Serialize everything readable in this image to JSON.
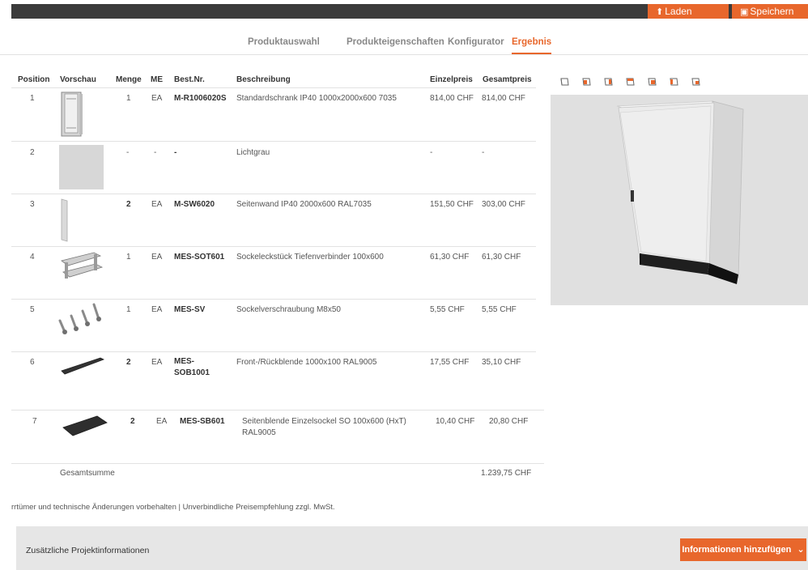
{
  "toolbar": {
    "load_label": "Laden",
    "save_label": "Speichern"
  },
  "tabs": [
    "Produktauswahl",
    "Produkteigenschaften",
    "Konfigurator",
    "Ergebnis"
  ],
  "table": {
    "headers": [
      "Position",
      "Vorschau",
      "Menge",
      "ME",
      "Best.Nr.",
      "Beschreibung",
      "Einzelpreis",
      "Gesamtpreis"
    ],
    "rows": [
      {
        "pos": "1",
        "qty": "1",
        "unit": "EA",
        "part": "M-R1006020S",
        "desc": "Standardschrank IP40 1000x2000x600 7035",
        "unit_price": "814,00 CHF",
        "total": "814,00 CHF"
      },
      {
        "pos": "2",
        "qty": "-",
        "unit": "-",
        "part": "-",
        "desc": "Lichtgrau",
        "unit_price": "-",
        "total": "-"
      },
      {
        "pos": "3",
        "qty": "2",
        "unit": "EA",
        "part": "M-SW6020",
        "desc": "Seitenwand IP40 2000x600 RAL7035",
        "unit_price": "151,50 CHF",
        "total": "303,00 CHF"
      },
      {
        "pos": "4",
        "qty": "1",
        "unit": "EA",
        "part": "MES-SOT601",
        "desc": "Sockeleckstück Tiefenverbinder 100x600",
        "unit_price": "61,30 CHF",
        "total": "61,30 CHF"
      },
      {
        "pos": "5",
        "qty": "1",
        "unit": "EA",
        "part": "MES-SV",
        "desc": "Sockelverschraubung M8x50",
        "unit_price": "5,55 CHF",
        "total": "5,55 CHF"
      },
      {
        "pos": "6",
        "qty": "2",
        "unit": "EA",
        "part": "MES-SOB1001",
        "desc": "Front-/Rückblende 1000x100 RAL9005",
        "unit_price": "17,55 CHF",
        "total": "35,10 CHF"
      },
      {
        "pos": "7",
        "qty": "2",
        "unit": "EA",
        "part": "MES-SB601",
        "desc": "Seitenblende Einzelsockel SO 100x600 (HxT) RAL9005",
        "unit_price": "10,40 CHF",
        "total": "20,80 CHF"
      }
    ],
    "sum_label": "Gesamtsumme",
    "sum_value": "1.239,75 CHF"
  },
  "disclaimer": "rrtümer und technische Änderungen vorbehalten | Unverbindliche Preisempfehlung zzgl. MwSt.",
  "footer": {
    "title": "Zusätzliche Projektinformationen",
    "button_label": "Informationen hinzufügen"
  },
  "view_icons": [
    "view-iso-front-left-icon",
    "view-front-icon",
    "view-right-icon",
    "view-top-icon",
    "view-back-icon",
    "view-left-icon",
    "view-iso-back-right-icon"
  ],
  "colors": {
    "accent": "#e8672c",
    "topbar": "#3b3b3b",
    "footer_bg": "#e6e6e6",
    "preview_bg": "#e0e0e0"
  }
}
